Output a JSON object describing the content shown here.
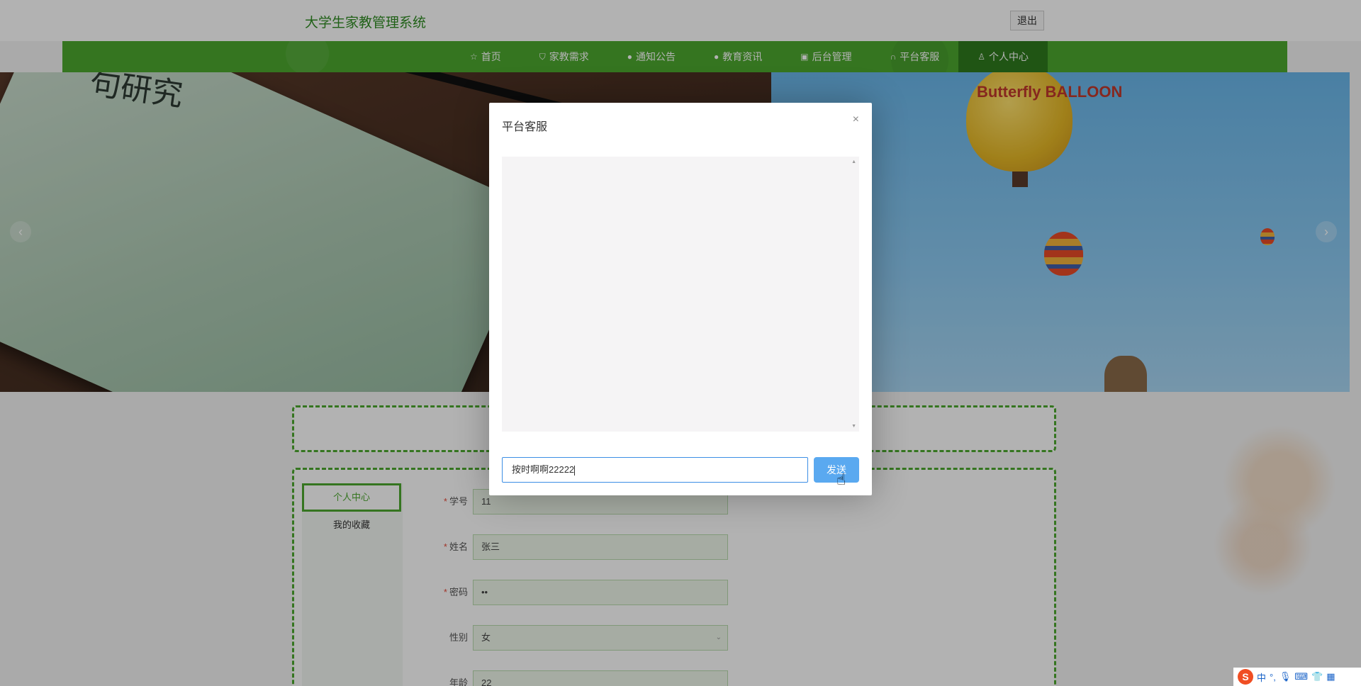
{
  "header": {
    "site_title": "大学生家教管理系统",
    "logout_label": "退出"
  },
  "nav": {
    "items": [
      {
        "label": "首页",
        "icon": "star-icon"
      },
      {
        "label": "家教需求",
        "icon": "bag-icon"
      },
      {
        "label": "通知公告",
        "icon": "info-icon"
      },
      {
        "label": "教育资讯",
        "icon": "info-icon"
      },
      {
        "label": "后台管理",
        "icon": "gift-icon"
      },
      {
        "label": "平台客服",
        "icon": "headset-icon"
      },
      {
        "label": "个人中心",
        "icon": "user-icon",
        "active": true
      }
    ]
  },
  "banner": {
    "book_text": "句研究",
    "balloon_text": "Butterfly BALLOON"
  },
  "sidebar": {
    "active_label": "个人中心",
    "items": [
      {
        "label": "我的收藏"
      }
    ]
  },
  "form": {
    "fields": [
      {
        "label": "学号",
        "value": "11",
        "required": true
      },
      {
        "label": "姓名",
        "value": "张三",
        "required": true
      },
      {
        "label": "密码",
        "value": "••",
        "required": true
      },
      {
        "label": "性别",
        "value": "女",
        "required": false,
        "type": "select"
      },
      {
        "label": "年龄",
        "value": "22",
        "required": false
      }
    ]
  },
  "modal": {
    "title": "平台客服",
    "close_glyph": "×",
    "input_value": "按时啊啊22222",
    "send_label": "发送"
  },
  "ime": {
    "label": "中",
    "punct": "°,"
  }
}
